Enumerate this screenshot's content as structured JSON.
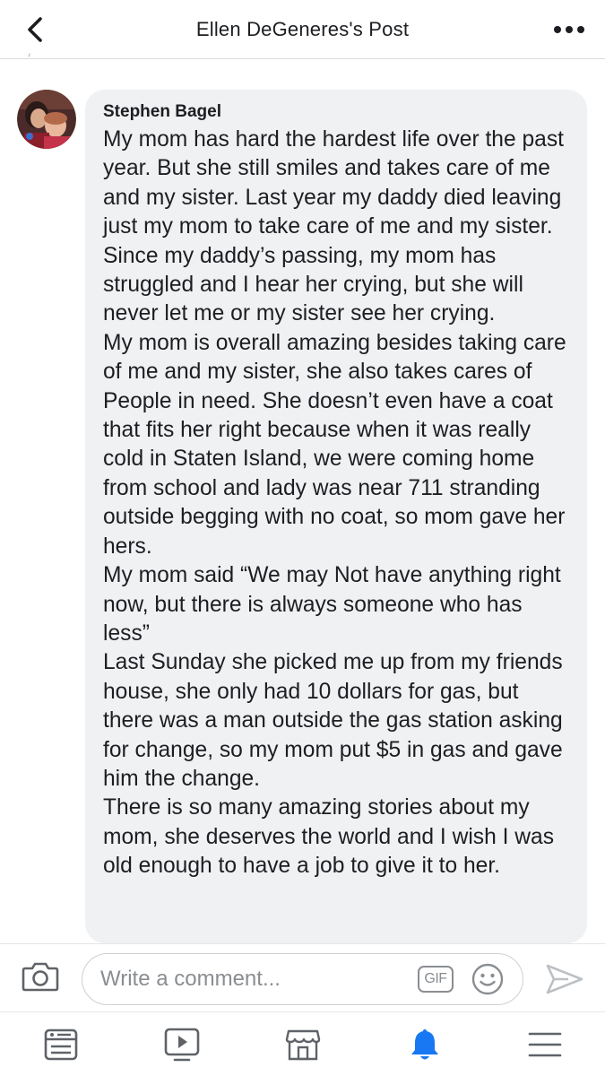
{
  "header": {
    "title": "Ellen DeGeneres's Post"
  },
  "comment": {
    "author": "Stephen Bagel",
    "paragraphs": [
      "My mom has hard the hardest life over the past year. But she still smiles and takes care of me and my sister. Last year my daddy died leaving just my mom to take care of me and my sister. Since my daddy’s passing, my mom has struggled and I hear her crying, but she will never let me or my sister see her crying.",
      "My mom is overall amazing besides taking care of me and my sister, she also takes cares of People in need. She doesn’t even have a coat that fits her right because when it was really cold in Staten Island, we were coming home from school and lady was near 711 stranding outside begging with no coat, so mom gave her hers.",
      "My mom said “We may Not have anything right now, but there is always someone who has less”",
      "Last Sunday she picked me up from my friends house, she only had 10 dollars for gas, but there was a man outside the gas station asking for change, so my mom put $5 in gas and gave him the change.",
      "There is so many amazing stories about my mom, she deserves the world and I wish I was old enough to have a job to give it to her."
    ]
  },
  "composer": {
    "placeholder": "Write a comment...",
    "value": "",
    "gif_label": "GIF"
  },
  "icons": {
    "back": "chevron-left-icon",
    "more": "more-dots-icon",
    "camera": "camera-icon",
    "emoji": "emoji-icon",
    "send": "send-icon",
    "tabs": [
      "news-feed-icon",
      "watch-icon",
      "marketplace-icon",
      "notifications-bell-icon",
      "menu-icon"
    ]
  },
  "colors": {
    "accent": "#1877f2",
    "bubble": "#f0f1f3",
    "icon_gray": "#5f6368"
  }
}
